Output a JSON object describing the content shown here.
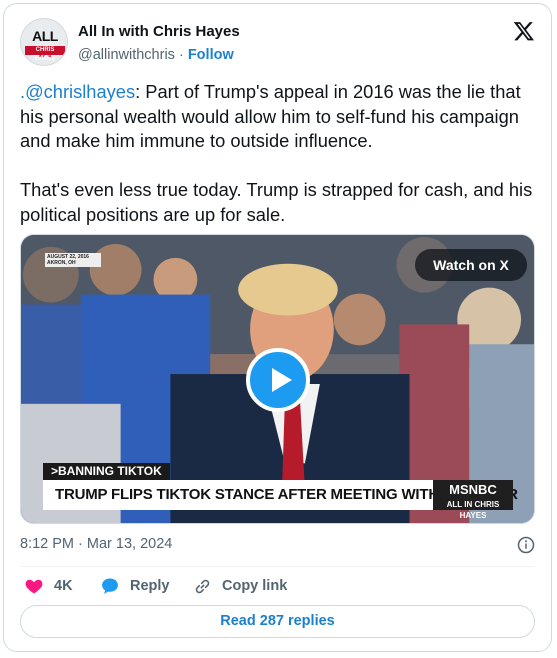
{
  "author": {
    "name": "All In with Chris Hayes",
    "handle": "@allinwithchris",
    "separator": "·",
    "follow_label": "Follow",
    "avatar_text_all": "ALL ",
    "avatar_text_in": "IN",
    "avatar_subtext": "CHRIS HAYES"
  },
  "tweet": {
    "mention": ".@chrislhayes",
    "paragraph1_rest": ": Part of Trump's appeal in 2016 was the lie that his personal wealth would allow him to self-fund his campaign and make him immune to outside influence.",
    "paragraph2": "That's even less true today. Trump is strapped for cash, and his political positions are up for sale."
  },
  "media": {
    "watch_label": "Watch on X",
    "date_tag_line1": "AUGUST 22, 2016",
    "date_tag_line2": "AKRON, OH",
    "lower_tag": ">BANNING TIKTOK",
    "headline": "TRUMP FLIPS TIKTOK STANCE AFTER MEETING WITH INVESTOR",
    "network": "MSNBC",
    "show": "ALL IN CHRIS HAYES"
  },
  "timestamp": "8:12 PM · Mar 13, 2024",
  "actions": {
    "like_count": "4K",
    "reply_label": "Reply",
    "copy_label": "Copy link"
  },
  "read_replies_label": "Read 287 replies",
  "colors": {
    "link": "#1d7fd0",
    "like": "#f91880",
    "reply": "#1d9bf0",
    "secondary": "#536471"
  }
}
